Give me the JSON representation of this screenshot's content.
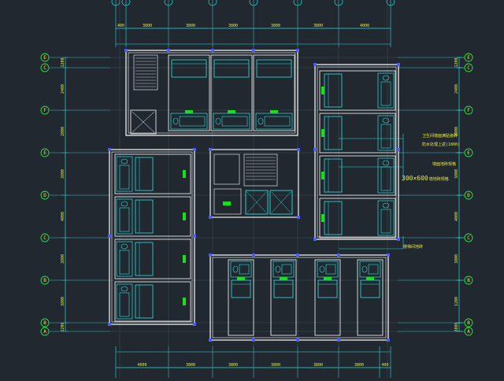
{
  "canvas": {
    "background": "#212830"
  },
  "colors": {
    "wall": "#ffffff",
    "fixture": "#2de0e0",
    "dim": "#25e0d8",
    "text": "#e8e84a",
    "axisCircle": "#2fe040",
    "label": "#19e019",
    "column": "#4a5cff",
    "gridline": "#4a5866"
  },
  "dimensions": {
    "top": [
      "400",
      "3800",
      "3800",
      "3800",
      "3800",
      "3800",
      "4000"
    ],
    "bottom": [
      "4000",
      "3800",
      "3800",
      "3800",
      "3800",
      "3800",
      "400"
    ],
    "left": [
      "1200",
      "2400",
      "2800",
      "3800",
      "4000",
      "3800",
      "3800",
      "1200"
    ],
    "right": [
      "1200",
      "2400",
      "2800",
      "3800",
      "4000",
      "3800",
      "1200",
      "3800",
      "1200"
    ]
  },
  "axes": {
    "left": [
      "E",
      "C",
      "F",
      "E",
      "D",
      "C",
      "B",
      "B",
      "A"
    ],
    "right": [
      "E",
      "C",
      "F",
      "E",
      "D",
      "C",
      "B",
      "B",
      "A"
    ]
  },
  "annotations": {
    "note1": "卫生间墙面满贴瓷砖",
    "note2": "防水处理上返(1800)",
    "note3": "墙面地砖规格",
    "size": "300×600",
    "size_suffix": "墙地砖规格",
    "note4": "楼梯间地砖"
  }
}
